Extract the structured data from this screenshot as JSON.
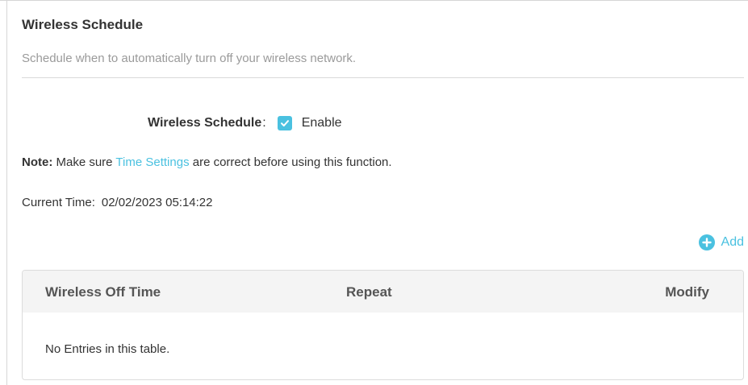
{
  "section": {
    "title": "Wireless Schedule",
    "description": "Schedule when to automatically turn off your wireless network."
  },
  "wireless_schedule": {
    "label": "Wireless Schedule",
    "colon": ":",
    "checkbox_checked": true,
    "enable_label": "Enable"
  },
  "note": {
    "prefix": "Note:",
    "text_before": " Make sure ",
    "link": "Time Settings",
    "text_after": " are correct before using this function."
  },
  "current_time": {
    "label": "Current Time:",
    "value": "02/02/2023 05:14:22"
  },
  "add_button": {
    "label": "Add",
    "icon": "plus-circle-icon"
  },
  "table": {
    "columns": [
      "Wireless Off Time",
      "Repeat",
      "Modify"
    ],
    "empty_text": "No Entries in this table."
  },
  "colors": {
    "accent": "#4ac1e0",
    "text": "#333333",
    "muted": "#9a9a9a",
    "table_header_bg": "#f4f4f4"
  }
}
